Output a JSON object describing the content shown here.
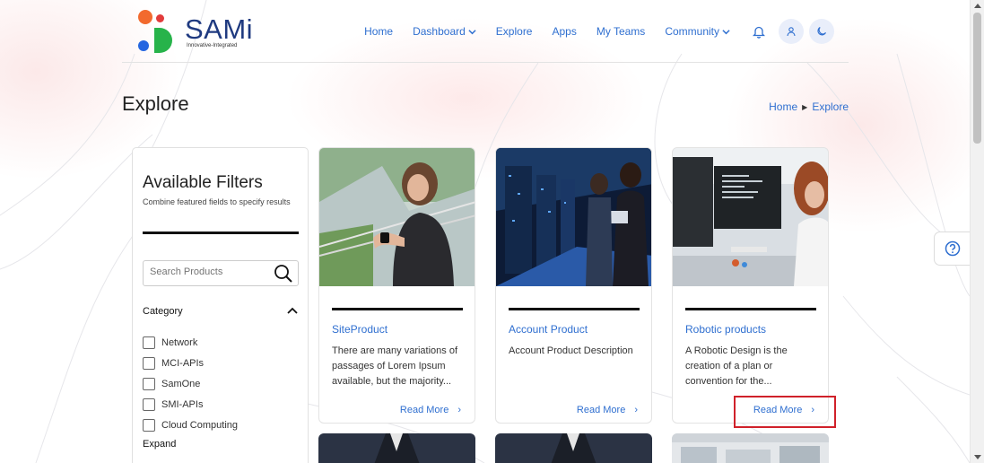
{
  "brand": {
    "name": "SAMi",
    "tagline": "Innovative-Integrated",
    "colors": {
      "orange": "#f26a2e",
      "green": "#27b34a",
      "blue": "#2566e0",
      "red": "#e23b3b",
      "navy": "#1f3a80"
    }
  },
  "nav": {
    "home": "Home",
    "dashboard": "Dashboard",
    "explore": "Explore",
    "apps": "Apps",
    "my_teams": "My Teams",
    "community": "Community",
    "icons": [
      "bell-icon",
      "user-icon",
      "moon-icon"
    ]
  },
  "page": {
    "title": "Explore",
    "breadcrumb": [
      "Home",
      "Explore"
    ]
  },
  "filters": {
    "title": "Available Filters",
    "subtitle": "Combine featured fields to specify results",
    "search_placeholder": "Search Products",
    "category_label": "Category",
    "categories": [
      "Network",
      "MCI-APIs",
      "SamOne",
      "SMI-APIs",
      "Cloud Computing"
    ],
    "expand_label": "Expand"
  },
  "products": [
    {
      "title": "SiteProduct",
      "description": "There are many variations of passages of Lorem Ipsum available, but the majority...",
      "action": "Read More"
    },
    {
      "title": "Account Product",
      "description": "Account Product Description",
      "action": "Read More"
    },
    {
      "title": "Robotic products",
      "description": "A Robotic Design is the creation of a plan or convention for the...",
      "action": "Read More"
    }
  ],
  "accent_color": "#2f6fd0",
  "highlight_color": "#d0212a"
}
